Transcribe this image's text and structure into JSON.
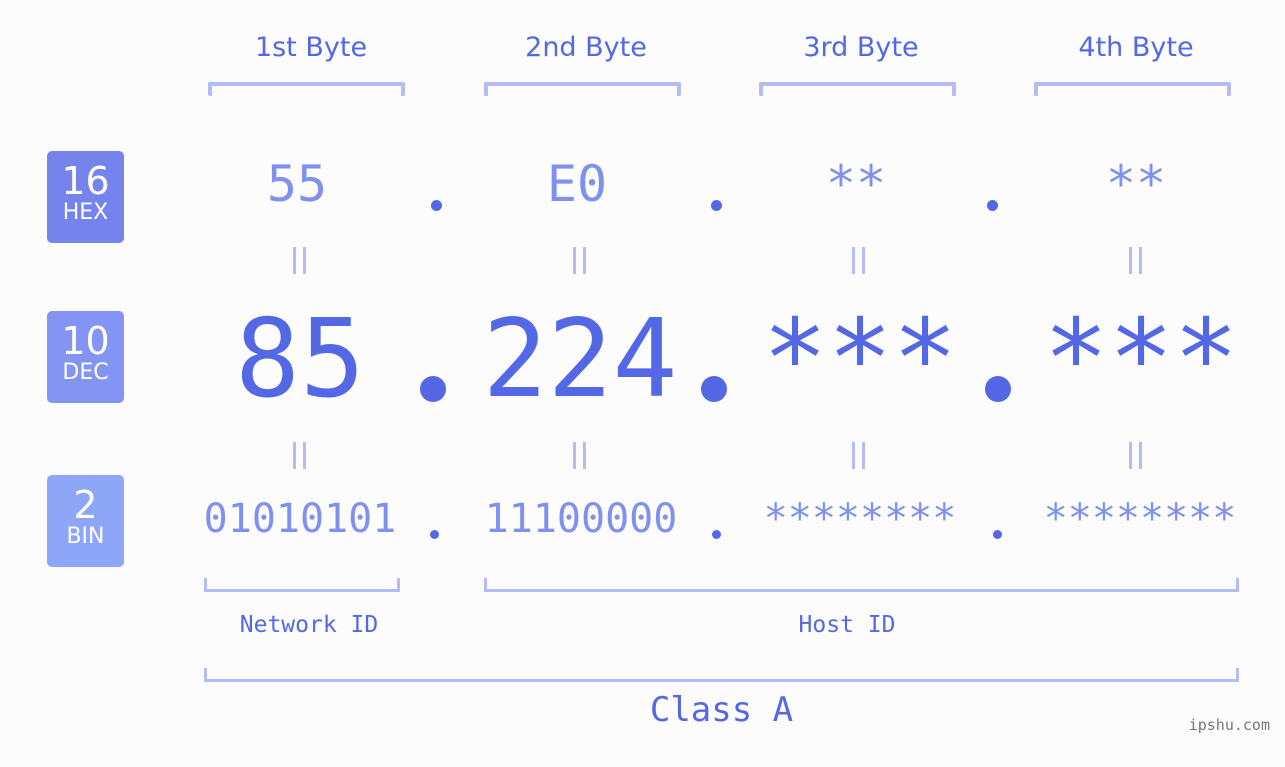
{
  "bytes": [
    {
      "label": "1st Byte",
      "hex": "55",
      "dec": "85",
      "bin": "01010101"
    },
    {
      "label": "2nd Byte",
      "hex": "E0",
      "dec": "224",
      "bin": "11100000"
    },
    {
      "label": "3rd Byte",
      "hex": "**",
      "dec": "***",
      "bin": "********"
    },
    {
      "label": "4th Byte",
      "hex": "**",
      "dec": "***",
      "bin": "********"
    }
  ],
  "bases": {
    "hex": {
      "num": "16",
      "label": "HEX",
      "color": "#7583ec"
    },
    "dec": {
      "num": "10",
      "label": "DEC",
      "color": "#8494f2"
    },
    "bin": {
      "num": "2",
      "label": "BIN",
      "color": "#8da6f8"
    }
  },
  "equals_symbol": "=",
  "network_label": "Network ID",
  "host_label": "Host ID",
  "class_label": "Class A",
  "watermark": "ipshu.com",
  "colors": {
    "accent": "#5468e6",
    "light_accent": "#8090ee",
    "bracket": "#b3bcf5",
    "background": "#fbfcfb"
  }
}
